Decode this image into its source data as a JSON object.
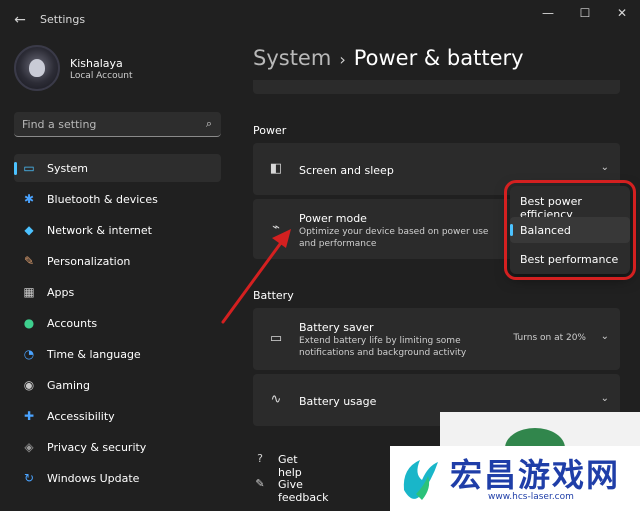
{
  "window": {
    "title": "Settings",
    "back_icon": "back-arrow-icon",
    "minimize_glyph": "—",
    "maximize_glyph": "☐",
    "close_glyph": "✕"
  },
  "account": {
    "name": "Kishalaya",
    "type": "Local Account"
  },
  "search": {
    "placeholder": "Find a setting",
    "icon": "⌕"
  },
  "sidebar": {
    "items": [
      {
        "label": "System",
        "icon": "▭",
        "color": "#4cc2ff",
        "active": true
      },
      {
        "label": "Bluetooth & devices",
        "icon": "✱",
        "color": "#4aa3ff"
      },
      {
        "label": "Network & internet",
        "icon": "◆",
        "color": "#4cc2ff"
      },
      {
        "label": "Personalization",
        "icon": "✎",
        "color": "#e0a070"
      },
      {
        "label": "Apps",
        "icon": "▦",
        "color": "#c8c8c8"
      },
      {
        "label": "Accounts",
        "icon": "●",
        "color": "#3ecf8e"
      },
      {
        "label": "Time & language",
        "icon": "◔",
        "color": "#4aa3ff"
      },
      {
        "label": "Gaming",
        "icon": "◉",
        "color": "#c8c8c8"
      },
      {
        "label": "Accessibility",
        "icon": "✚",
        "color": "#4aa3ff"
      },
      {
        "label": "Privacy & security",
        "icon": "◈",
        "color": "#9a9a9a"
      },
      {
        "label": "Windows Update",
        "icon": "↻",
        "color": "#4aa3ff"
      }
    ]
  },
  "header": {
    "parent": "System",
    "separator": "›",
    "current": "Power & battery"
  },
  "power": {
    "section_title": "Power",
    "screen_sleep": {
      "title": "Screen and sleep",
      "icon": "◧",
      "chevron": "⌄"
    },
    "power_mode": {
      "title": "Power mode",
      "description": "Optimize your device based on power use and performance",
      "icon": "⌁"
    }
  },
  "battery": {
    "section_title": "Battery",
    "saver": {
      "title": "Battery saver",
      "description": "Extend battery life by limiting some notifications and background activity",
      "status": "Turns on at 20%",
      "icon": "▭",
      "chevron": "⌄"
    },
    "usage": {
      "title": "Battery usage",
      "icon": "∿",
      "chevron": "⌄"
    }
  },
  "dropdown": {
    "options": [
      {
        "label": "Best power efficiency"
      },
      {
        "label": "Balanced",
        "selected": true
      },
      {
        "label": "Best performance"
      }
    ]
  },
  "footer": {
    "help": {
      "label": "Get help",
      "icon": "?"
    },
    "feedback": {
      "label": "Give feedback",
      "icon": "✎"
    }
  },
  "watermark": {
    "title": "宏昌游戏网",
    "url": "www.hcs-laser.com"
  },
  "colors": {
    "accent": "#4cc2ff",
    "annotation": "#d42020"
  }
}
